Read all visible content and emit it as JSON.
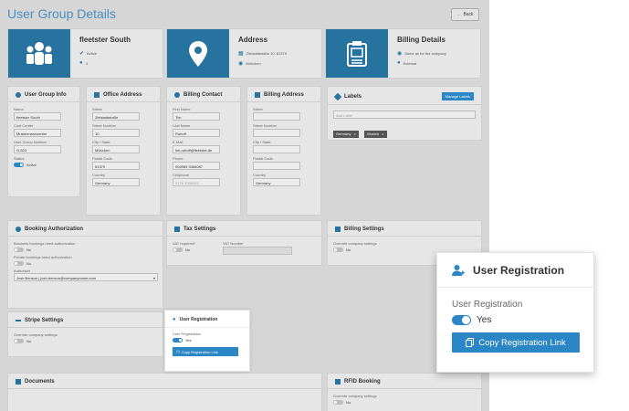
{
  "page": {
    "title": "User Group Details",
    "back_label": "Back"
  },
  "hero": [
    {
      "title": "fleetster South",
      "rows": [
        "Active",
        "4"
      ]
    },
    {
      "title": "Address",
      "rows": [
        "Zielstattstraße 10, 81379",
        "München"
      ]
    },
    {
      "title": "Billing Details",
      "rows": [
        "Same as for the company",
        "External"
      ]
    }
  ],
  "user_group_info": {
    "title": "User Group Info",
    "fields": [
      {
        "label": "Name",
        "value": "fleetster South"
      },
      {
        "label": "Cost Center",
        "value": "Mustermannzentre"
      },
      {
        "label": "User Group Number",
        "value": "G-523"
      }
    ],
    "status_label": "Status",
    "status_value": "Active"
  },
  "office_address": {
    "title": "Office Address",
    "fields": [
      {
        "label": "Street",
        "value": "Zielstattstraße"
      },
      {
        "label": "Street Number",
        "value": "10"
      },
      {
        "label": "City / State",
        "value": "München"
      },
      {
        "label": "Postal Code",
        "value": "81379"
      },
      {
        "label": "Country",
        "value": "Germany"
      }
    ]
  },
  "billing_contact": {
    "title": "Billing Contact",
    "fields": [
      {
        "label": "First Name",
        "value": "Tim"
      },
      {
        "label": "Last Name",
        "value": "Ruhoff"
      },
      {
        "label": "E-Mail",
        "value": "tim.ruhoff@fleetster.de"
      },
      {
        "label": "Phone",
        "value": "004989 3366087"
      },
      {
        "label": "Cellphone",
        "value": "0176 3266053"
      }
    ]
  },
  "billing_address": {
    "title": "Billing Address",
    "fields": [
      {
        "label": "Street",
        "value": ""
      },
      {
        "label": "Street Number",
        "value": ""
      },
      {
        "label": "City / State",
        "value": ""
      },
      {
        "label": "Postal Code",
        "value": ""
      },
      {
        "label": "Country",
        "value": "Germany"
      }
    ]
  },
  "labels": {
    "title": "Labels",
    "manage_label": "Manage Labels",
    "placeholder": "Add Label",
    "tags": [
      "Germany",
      "Munich"
    ]
  },
  "booking_auth": {
    "title": "Booking Authorization",
    "items": [
      {
        "label": "Business bookings need authorization",
        "value": "No"
      },
      {
        "label": "Private bookings need authorization",
        "value": "No"
      }
    ],
    "authorizer_label": "Authorizer",
    "authorizer_value": "Josh Benson | josh.benson@companyname.com"
  },
  "tax": {
    "title": "Tax Settings",
    "vat_required_label": "VAT required?",
    "vat_required_value": "No",
    "vat_number_label": "VAT Number"
  },
  "billing_settings": {
    "title": "Billing Settings",
    "override_label": "Override company settings",
    "override_value": "No"
  },
  "stripe": {
    "title": "Stripe Settings",
    "override_label": "Override company settings",
    "override_value": "No"
  },
  "documents": {
    "title": "Documents"
  },
  "rfid": {
    "title": "RFID Booking",
    "override_label": "Override company settings",
    "override_value": "No"
  },
  "user_registration": {
    "title": "User Registration",
    "toggle_label": "User Registration",
    "toggle_value": "Yes",
    "button_label": "Copy Registration Link"
  },
  "colors": {
    "accent": "#2b86c5",
    "tile": "#26739f",
    "title": "#4a8fbf"
  }
}
